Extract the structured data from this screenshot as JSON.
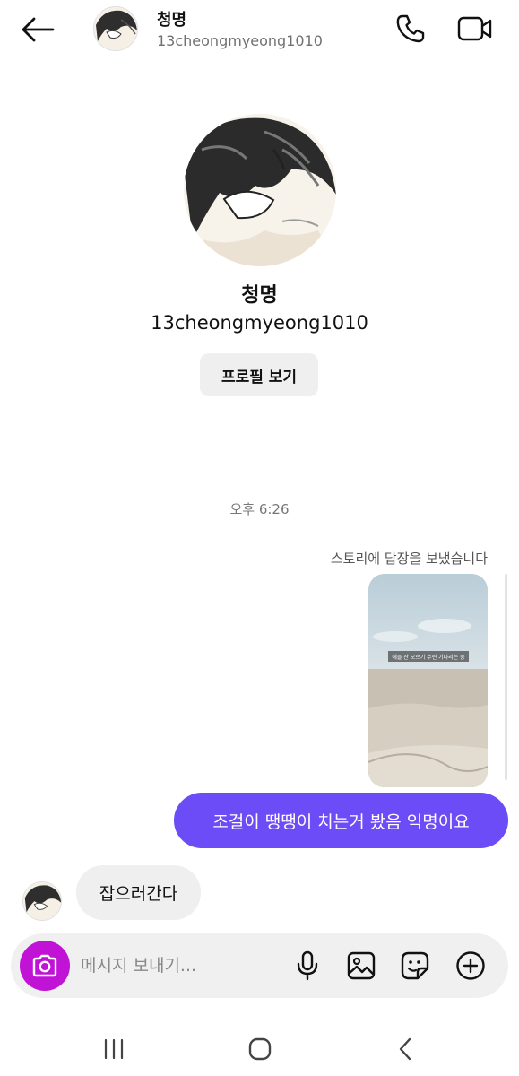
{
  "header": {
    "name": "청명",
    "handle": "13cheongmyeong1010"
  },
  "profile": {
    "name": "청명",
    "handle": "13cheongmyeong1010",
    "view_profile_label": "프로필 보기"
  },
  "chat": {
    "time": "오후 6:26",
    "story_reply_label": "스토리에 답장을 보냈습니다",
    "story_caption": "에들 산 오르기 수련 기다리는 중",
    "sent_message": "조걸이 땡땡이 치는거 봤음 익명이요",
    "received_message": "잡으러간다"
  },
  "composer": {
    "placeholder": "메시지 보내기..."
  },
  "colors": {
    "sent_bubble": "#6b4cf6",
    "camera_button": "#c013d6",
    "received_bubble": "#efefef"
  },
  "icons": {
    "back": "back-arrow-icon",
    "call": "phone-icon",
    "video": "video-camera-icon",
    "camera": "camera-icon",
    "mic": "microphone-icon",
    "gallery": "image-icon",
    "sticker": "sticker-icon",
    "plus": "plus-circle-icon"
  }
}
